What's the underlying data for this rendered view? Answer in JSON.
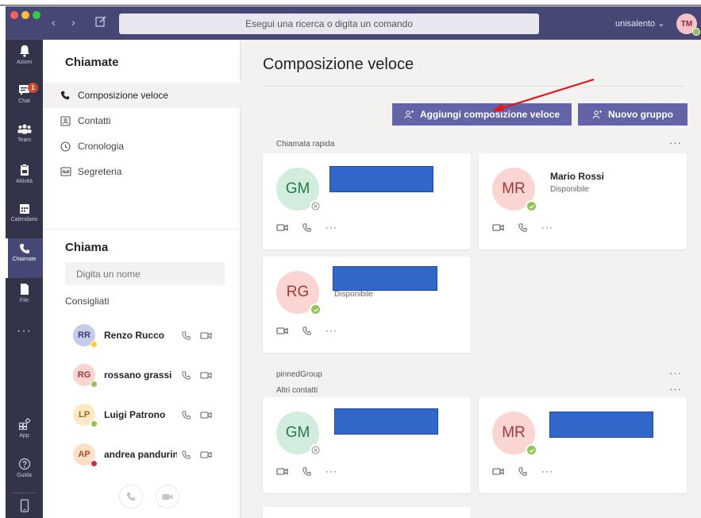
{
  "titlebar": {
    "search_placeholder": "Esegui una ricerca o digita un comando",
    "tenant": "unisalento ⌄",
    "user_initials": "TM"
  },
  "rail": [
    {
      "label": "Azioni",
      "icon": "bell-icon"
    },
    {
      "label": "Chat",
      "icon": "chat-icon",
      "badge": "1"
    },
    {
      "label": "Team",
      "icon": "teams-icon"
    },
    {
      "label": "Attività",
      "icon": "assignment-icon"
    },
    {
      "label": "Calendario",
      "icon": "calendar-icon"
    },
    {
      "label": "Chiamate",
      "icon": "phone-icon",
      "active": true
    },
    {
      "label": "File",
      "icon": "file-icon"
    },
    {
      "label": "App",
      "icon": "apps-icon"
    },
    {
      "label": "Guida",
      "icon": "help-icon"
    }
  ],
  "left": {
    "title": "Chiamate",
    "nav": [
      "Composizione veloce",
      "Contatti",
      "Cronologia",
      "Segreteria"
    ],
    "call_title": "Chiama",
    "name_placeholder": "Digita un nome",
    "suggested_label": "Consigliati",
    "contacts": [
      {
        "initials": "RR",
        "name": "Renzo Rucco",
        "bg": "#c5cbe9",
        "fg": "#3a3f7a",
        "status": "#f8d22a"
      },
      {
        "initials": "RG",
        "name": "rossano grassi",
        "bg": "#fbd5d2",
        "fg": "#a4373a",
        "status": "#92c353"
      },
      {
        "initials": "LP",
        "name": "Luigi Patrono",
        "bg": "#fde9c6",
        "fg": "#9a6a1e",
        "status": "#92c353"
      },
      {
        "initials": "AP",
        "name": "andrea pandurino",
        "bg": "#fde0c7",
        "fg": "#a0522d",
        "status": "#c4314b"
      }
    ]
  },
  "main": {
    "title": "Composizione veloce",
    "add_speed_dial": "Aggiungi composizione veloce",
    "new_group": "Nuovo gruppo",
    "group1_label": "Chiamata rapida",
    "group2_label": "pinnedGroup",
    "group3_label": "Altri contatti",
    "more": "···",
    "cards": [
      {
        "initials": "GM",
        "name": "",
        "status": "",
        "bg": "#d2ecdd",
        "fg": "#237b4b",
        "presence": "offline"
      },
      {
        "initials": "MR",
        "name": "Mario Rossi",
        "status": "Disponibile",
        "bg": "#fbd5d2",
        "fg": "#a4373a",
        "presence": "available"
      },
      {
        "initials": "RG",
        "name": "",
        "status": "Disponibile",
        "bg": "#fbd5d2",
        "fg": "#a4373a",
        "presence": "available"
      },
      {
        "initials": "GM",
        "name": "",
        "status": "",
        "bg": "#d2ecdd",
        "fg": "#237b4b",
        "presence": "offline"
      },
      {
        "initials": "MR",
        "name": "",
        "status": "",
        "bg": "#fbd5d2",
        "fg": "#a4373a",
        "presence": "available"
      }
    ]
  },
  "colors": {
    "accent": "#6264a7",
    "titlebar": "#464775",
    "rail": "#33344a",
    "available": "#92c353",
    "annotation_arrow": "#e8141c"
  }
}
